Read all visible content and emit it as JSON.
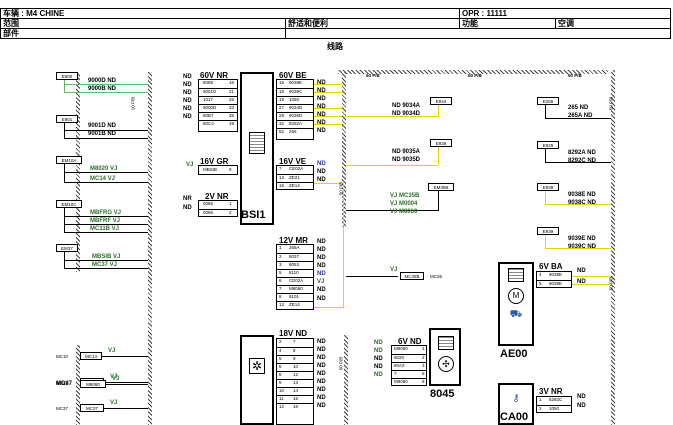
{
  "header": {
    "vehicle": "车辆 : M4 CHINE",
    "opr": "OPR : 11111",
    "scope_label": "范围",
    "scope_value": "舒适和便利",
    "function_label": "功能",
    "function_value": "空调",
    "part_label": "部件"
  },
  "section_title": "线路",
  "left_connectors": [
    {
      "id": "E900",
      "wires": [
        "9000D ND",
        "9000B ND"
      ]
    },
    {
      "id": "E901",
      "wires": [
        "9001D ND",
        "9001B ND"
      ]
    },
    {
      "id": "EM10A",
      "wires": [
        "M8020 VJ",
        "MC14 VJ"
      ]
    },
    {
      "id": "EM10C",
      "wires": [
        "MBFRG VJ",
        "MBFRF VJ",
        "MC11B VJ"
      ]
    },
    {
      "id": "EM37",
      "wires": [
        "MBSIB VJ",
        "MC37 VJ"
      ]
    }
  ],
  "ground_points": [
    {
      "id": "MC10",
      "tag": "MC14",
      "wire": "VJ"
    },
    {
      "id": "MC11",
      "tag": "MC11B",
      "wire": "VJ"
    },
    {
      "id": "MC37",
      "tag": "M8060",
      "wire": "VJ"
    },
    {
      "id": "MC37",
      "tag": "MC37",
      "wire": "VJ"
    }
  ],
  "bsi_left": {
    "c60vnr": {
      "name": "60V NR",
      "rows": [
        [
          "8088",
          "16"
        ],
        [
          "9001D",
          "21"
        ],
        [
          "1017",
          "26"
        ],
        [
          "9000D",
          "33"
        ],
        [
          "80B7",
          "35"
        ],
        [
          "80C4",
          "48"
        ]
      ],
      "wires": [
        "ND",
        "ND",
        "ND",
        "ND",
        "ND",
        "ND"
      ]
    },
    "c16vgr": {
      "name": "16V GR",
      "rows": [
        [
          "MBSIB",
          "9"
        ]
      ],
      "wire": "VJ"
    },
    "c2vnr": {
      "name": "2V NR",
      "rows": [
        [
          "0085",
          "1"
        ],
        [
          "0086",
          "2"
        ]
      ],
      "wires": [
        "NR",
        "ND"
      ]
    }
  },
  "bsi_label": "BSI1",
  "bsi_right": {
    "c60vbe": {
      "name": "60V BE",
      "rows": [
        [
          "16",
          "9038E"
        ],
        [
          "18",
          "9039C"
        ],
        [
          "19",
          "1050"
        ],
        [
          "27",
          "9034D"
        ],
        [
          "29",
          "9035D"
        ],
        [
          "32",
          "8292A"
        ],
        [
          "52",
          "265"
        ]
      ],
      "wires": [
        "ND",
        "ND",
        "ND",
        "ND",
        "ND",
        "ND",
        "ND"
      ]
    },
    "c16vve": {
      "name": "16V VE",
      "rows": [
        [
          "7",
          "CE02A"
        ],
        [
          "13",
          "ZE21"
        ],
        [
          "16",
          "ZE14"
        ]
      ],
      "wires": [
        "ND",
        "ND",
        "ND"
      ]
    },
    "c12vmr": {
      "name": "12V MR",
      "rows": [
        [
          "1",
          "265A"
        ],
        [
          "2",
          "8037"
        ],
        [
          "3",
          "8053"
        ],
        [
          "5",
          "8110"
        ],
        [
          "6",
          "CE02A"
        ],
        [
          "7",
          "M8060"
        ],
        [
          "8",
          "8101"
        ],
        [
          "12",
          "ZE14"
        ]
      ],
      "wires": [
        "ND",
        "ND",
        "ND",
        "ND",
        "ND",
        "VJ",
        "ND",
        "ND"
      ]
    },
    "c18vnd": {
      "name": "18V ND",
      "rows": [
        [
          "2",
          "7"
        ],
        [
          "4",
          "8"
        ],
        [
          "5",
          "9"
        ],
        [
          "6",
          "10"
        ],
        [
          "8",
          "12"
        ],
        [
          "9",
          "13"
        ],
        [
          "10",
          "14"
        ],
        [
          "11",
          "15"
        ],
        [
          "12",
          "16"
        ]
      ],
      "wires": [
        "ND",
        "ND",
        "ND",
        "ND",
        "ND",
        "ND",
        "ND",
        "ND",
        "ND"
      ]
    }
  },
  "bus_labels": [
    "50 P/B",
    "50 P/B",
    "50 P/B"
  ],
  "middle_wires": [
    {
      "conn": "E934",
      "wires": [
        "ND 9034A",
        "ND 9034D"
      ]
    },
    {
      "conn": "E935",
      "wires": [
        "ND 9035A",
        "ND 9035D"
      ]
    },
    {
      "conn": "EM35B",
      "wires": [
        "VJ MC35B",
        "VJ M0004",
        "VJ M8060"
      ]
    }
  ],
  "mc35": {
    "tag": "MC35B",
    "label": "MC35",
    "wire": "VJ"
  },
  "right_wires": [
    {
      "conn": "E265",
      "wires": [
        "265 ND",
        "265A ND"
      ]
    },
    {
      "conn": "E829",
      "wires": [
        "8292A ND",
        "8292C ND"
      ]
    },
    {
      "conn": "E938",
      "wires": [
        "9038E ND",
        "9038C ND"
      ]
    },
    {
      "conn": "E939",
      "wires": [
        "9039E ND",
        "9039C ND"
      ]
    }
  ],
  "ae00": {
    "name": "AE00",
    "conn": "6V BA",
    "rows": [
      [
        "4",
        "9038E"
      ],
      [
        "5",
        "9039E"
      ]
    ],
    "wires": [
      "ND",
      "ND"
    ]
  },
  "m8045": {
    "name": "8045",
    "conn": "6V ND",
    "rows": [
      [
        "M8050",
        "1"
      ],
      [
        "8020",
        "2"
      ],
      [
        "80A3",
        "3"
      ],
      [
        "7",
        "5"
      ],
      [
        "M8060",
        "6"
      ]
    ],
    "wires": [
      "ND",
      "ND",
      "ND",
      "ND",
      "ND"
    ]
  },
  "ca00": {
    "name": "CA00",
    "conn": "3V NR",
    "rows": [
      [
        "1",
        "8292C"
      ],
      [
        "2",
        "1050"
      ]
    ],
    "wires": [
      "ND",
      "ND"
    ]
  },
  "side_labels": [
    "10 P/B",
    "50 P/B",
    "50 P/B",
    "50 P/B",
    "50 P/B"
  ]
}
